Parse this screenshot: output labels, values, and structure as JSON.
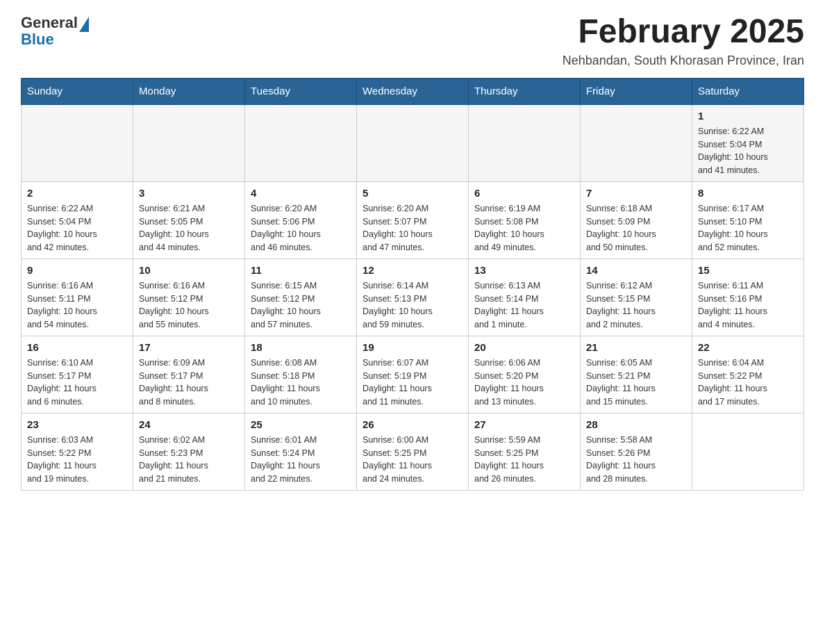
{
  "header": {
    "logo": {
      "text_general": "General",
      "text_blue": "Blue"
    },
    "title": "February 2025",
    "subtitle": "Nehbandan, South Khorasan Province, Iran"
  },
  "days_of_week": [
    "Sunday",
    "Monday",
    "Tuesday",
    "Wednesday",
    "Thursday",
    "Friday",
    "Saturday"
  ],
  "weeks": [
    [
      {
        "day": "",
        "info": ""
      },
      {
        "day": "",
        "info": ""
      },
      {
        "day": "",
        "info": ""
      },
      {
        "day": "",
        "info": ""
      },
      {
        "day": "",
        "info": ""
      },
      {
        "day": "",
        "info": ""
      },
      {
        "day": "1",
        "info": "Sunrise: 6:22 AM\nSunset: 5:04 PM\nDaylight: 10 hours\nand 41 minutes."
      }
    ],
    [
      {
        "day": "2",
        "info": "Sunrise: 6:22 AM\nSunset: 5:04 PM\nDaylight: 10 hours\nand 42 minutes."
      },
      {
        "day": "3",
        "info": "Sunrise: 6:21 AM\nSunset: 5:05 PM\nDaylight: 10 hours\nand 44 minutes."
      },
      {
        "day": "4",
        "info": "Sunrise: 6:20 AM\nSunset: 5:06 PM\nDaylight: 10 hours\nand 46 minutes."
      },
      {
        "day": "5",
        "info": "Sunrise: 6:20 AM\nSunset: 5:07 PM\nDaylight: 10 hours\nand 47 minutes."
      },
      {
        "day": "6",
        "info": "Sunrise: 6:19 AM\nSunset: 5:08 PM\nDaylight: 10 hours\nand 49 minutes."
      },
      {
        "day": "7",
        "info": "Sunrise: 6:18 AM\nSunset: 5:09 PM\nDaylight: 10 hours\nand 50 minutes."
      },
      {
        "day": "8",
        "info": "Sunrise: 6:17 AM\nSunset: 5:10 PM\nDaylight: 10 hours\nand 52 minutes."
      }
    ],
    [
      {
        "day": "9",
        "info": "Sunrise: 6:16 AM\nSunset: 5:11 PM\nDaylight: 10 hours\nand 54 minutes."
      },
      {
        "day": "10",
        "info": "Sunrise: 6:16 AM\nSunset: 5:12 PM\nDaylight: 10 hours\nand 55 minutes."
      },
      {
        "day": "11",
        "info": "Sunrise: 6:15 AM\nSunset: 5:12 PM\nDaylight: 10 hours\nand 57 minutes."
      },
      {
        "day": "12",
        "info": "Sunrise: 6:14 AM\nSunset: 5:13 PM\nDaylight: 10 hours\nand 59 minutes."
      },
      {
        "day": "13",
        "info": "Sunrise: 6:13 AM\nSunset: 5:14 PM\nDaylight: 11 hours\nand 1 minute."
      },
      {
        "day": "14",
        "info": "Sunrise: 6:12 AM\nSunset: 5:15 PM\nDaylight: 11 hours\nand 2 minutes."
      },
      {
        "day": "15",
        "info": "Sunrise: 6:11 AM\nSunset: 5:16 PM\nDaylight: 11 hours\nand 4 minutes."
      }
    ],
    [
      {
        "day": "16",
        "info": "Sunrise: 6:10 AM\nSunset: 5:17 PM\nDaylight: 11 hours\nand 6 minutes."
      },
      {
        "day": "17",
        "info": "Sunrise: 6:09 AM\nSunset: 5:17 PM\nDaylight: 11 hours\nand 8 minutes."
      },
      {
        "day": "18",
        "info": "Sunrise: 6:08 AM\nSunset: 5:18 PM\nDaylight: 11 hours\nand 10 minutes."
      },
      {
        "day": "19",
        "info": "Sunrise: 6:07 AM\nSunset: 5:19 PM\nDaylight: 11 hours\nand 11 minutes."
      },
      {
        "day": "20",
        "info": "Sunrise: 6:06 AM\nSunset: 5:20 PM\nDaylight: 11 hours\nand 13 minutes."
      },
      {
        "day": "21",
        "info": "Sunrise: 6:05 AM\nSunset: 5:21 PM\nDaylight: 11 hours\nand 15 minutes."
      },
      {
        "day": "22",
        "info": "Sunrise: 6:04 AM\nSunset: 5:22 PM\nDaylight: 11 hours\nand 17 minutes."
      }
    ],
    [
      {
        "day": "23",
        "info": "Sunrise: 6:03 AM\nSunset: 5:22 PM\nDaylight: 11 hours\nand 19 minutes."
      },
      {
        "day": "24",
        "info": "Sunrise: 6:02 AM\nSunset: 5:23 PM\nDaylight: 11 hours\nand 21 minutes."
      },
      {
        "day": "25",
        "info": "Sunrise: 6:01 AM\nSunset: 5:24 PM\nDaylight: 11 hours\nand 22 minutes."
      },
      {
        "day": "26",
        "info": "Sunrise: 6:00 AM\nSunset: 5:25 PM\nDaylight: 11 hours\nand 24 minutes."
      },
      {
        "day": "27",
        "info": "Sunrise: 5:59 AM\nSunset: 5:25 PM\nDaylight: 11 hours\nand 26 minutes."
      },
      {
        "day": "28",
        "info": "Sunrise: 5:58 AM\nSunset: 5:26 PM\nDaylight: 11 hours\nand 28 minutes."
      },
      {
        "day": "",
        "info": ""
      }
    ]
  ]
}
